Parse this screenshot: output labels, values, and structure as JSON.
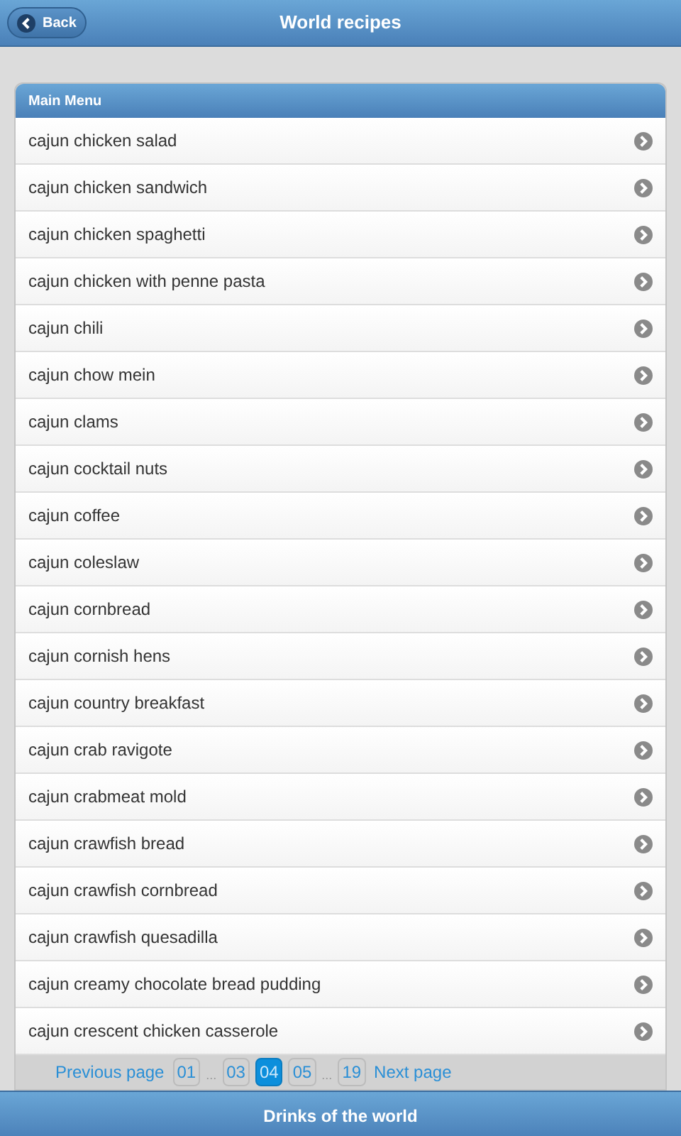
{
  "header": {
    "back": "Back",
    "title": "World recipes"
  },
  "menu": {
    "title": "Main Menu",
    "items": [
      "cajun chicken salad",
      "cajun chicken sandwich",
      "cajun chicken spaghetti",
      "cajun chicken with penne pasta",
      "cajun chili",
      "cajun chow mein",
      "cajun clams",
      "cajun cocktail nuts",
      "cajun coffee",
      "cajun coleslaw",
      "cajun cornbread",
      "cajun cornish hens",
      "cajun country breakfast",
      "cajun crab ravigote",
      "cajun crabmeat mold",
      "cajun crawfish bread",
      "cajun crawfish cornbread",
      "cajun crawfish quesadilla",
      "cajun creamy chocolate bread pudding",
      "cajun crescent chicken casserole"
    ]
  },
  "pager": [
    {
      "kind": "link",
      "label": "Previous page"
    },
    {
      "kind": "page",
      "label": "01",
      "selected": false
    },
    {
      "kind": "ellipsis",
      "label": "..."
    },
    {
      "kind": "page",
      "label": "03",
      "selected": false
    },
    {
      "kind": "page",
      "label": "04",
      "selected": true
    },
    {
      "kind": "page",
      "label": "05",
      "selected": false
    },
    {
      "kind": "ellipsis",
      "label": "..."
    },
    {
      "kind": "page",
      "label": "19",
      "selected": false
    },
    {
      "kind": "link",
      "label": "Next page"
    }
  ],
  "footer": {
    "title": "Drinks of the world"
  }
}
